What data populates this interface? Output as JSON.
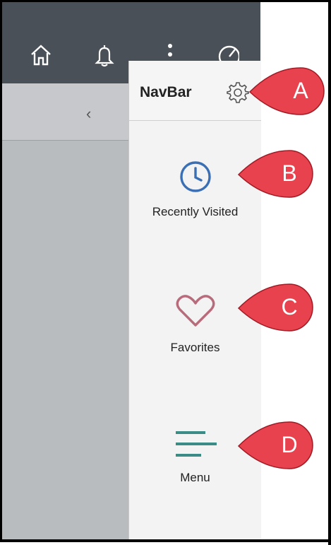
{
  "navbar": {
    "title": "NavBar",
    "items": [
      {
        "label": "Recently Visited"
      },
      {
        "label": "Favorites"
      },
      {
        "label": "Menu"
      }
    ]
  },
  "callouts": [
    "A",
    "B",
    "C",
    "D"
  ],
  "colors": {
    "header_bg": "#4a5057",
    "panel_bg": "#f3f3f3",
    "clock": "#3a6fb5",
    "heart": "#b86b7b",
    "menu": "#3b8b86",
    "callout": "#e8424e"
  }
}
